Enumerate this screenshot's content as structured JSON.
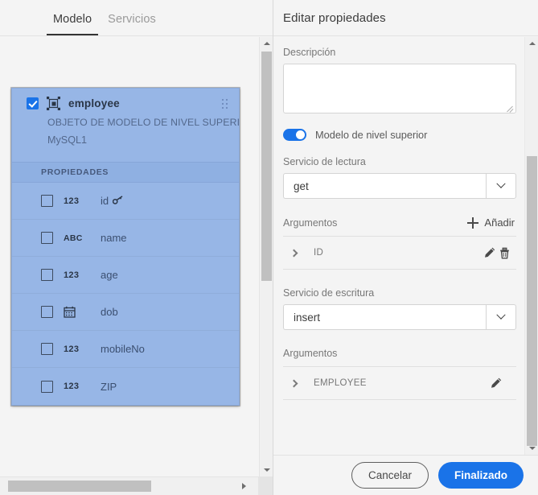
{
  "left": {
    "tabs": [
      {
        "label": "Modelo",
        "active": true
      },
      {
        "label": "Servicios",
        "active": false
      }
    ],
    "model_card": {
      "name": "employee",
      "icon": "model-object-icon",
      "checked": true,
      "subtitle": "OBJETO DE MODELO DE NIVEL SUPERIOR",
      "datasource": "MySQL1",
      "properties_header": "PROPIEDADES",
      "properties": [
        {
          "name": "id",
          "type": "123",
          "checked": false,
          "primary_key": true
        },
        {
          "name": "name",
          "type": "ABC",
          "checked": false,
          "primary_key": false
        },
        {
          "name": "age",
          "type": "123",
          "checked": false,
          "primary_key": false
        },
        {
          "name": "dob",
          "type": "calendar-icon",
          "checked": false,
          "primary_key": false
        },
        {
          "name": "mobileNo",
          "type": "123",
          "checked": false,
          "primary_key": false
        },
        {
          "name": "ZIP",
          "type": "123",
          "checked": false,
          "primary_key": false
        }
      ]
    }
  },
  "right": {
    "title": "Editar propiedades",
    "description": {
      "label": "Descripción",
      "value": "",
      "placeholder": ""
    },
    "toggle": {
      "label": "Modelo de nivel superior",
      "on": true
    },
    "read_service": {
      "label": "Servicio de lectura",
      "value": "get",
      "args_label": "Argumentos",
      "add_label": "Añadir",
      "args": [
        {
          "name": "ID",
          "has_edit": true,
          "has_delete": true
        }
      ]
    },
    "write_service": {
      "label": "Servicio de escritura",
      "value": "insert",
      "args_label": "Argumentos",
      "args": [
        {
          "name": "EMPLOYEE",
          "has_edit": true,
          "has_delete": false
        }
      ]
    },
    "footer": {
      "cancel": "Cancelar",
      "done": "Finalizado"
    }
  },
  "colors": {
    "accent": "#1a73e8",
    "card_bg": "#97b6e6",
    "panel_bg": "#f4f4f4"
  }
}
